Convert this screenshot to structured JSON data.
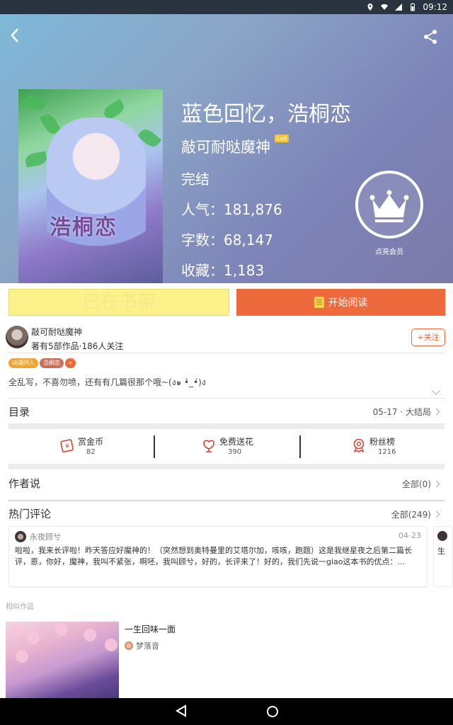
{
  "status_bar": {
    "time": "09:12"
  },
  "book": {
    "title": "蓝色回忆，浩桐恋",
    "author": "敲可耐哒魔神",
    "author_level": "Lv4",
    "status": "完结",
    "popularity": "人气：181,876",
    "word_count": "字数：68,147",
    "favorites": "收藏：1,183",
    "cover_text": "浩桐恋"
  },
  "vip": {
    "label": "点亮会员"
  },
  "buttons": {
    "on_shelf": "已在书架",
    "start_reading": "开始阅读"
  },
  "author_info": {
    "name": "敲可耐哒魔神",
    "meta": "著有5部作品·186人关注",
    "follow_label": "+关注"
  },
  "tags": [
    {
      "label": "动漫同人",
      "color": "#f0a431"
    },
    {
      "label": "浩桐恋",
      "color": "#c9705a"
    },
    {
      "label": "+",
      "color": "#ec6a3c"
    }
  ],
  "description": "全乱写，不喜勿喷，还有有几篇很那个哦~(ง๑ •̀_•́)ง",
  "catalog": {
    "title": "目录",
    "latest": "05-17 · 大结局"
  },
  "stats": [
    {
      "label": "赏金币",
      "value": "82",
      "icon": "reward-coin-icon"
    },
    {
      "label": "免费送花",
      "value": "390",
      "icon": "flower-icon"
    },
    {
      "label": "粉丝榜",
      "value": "1216",
      "icon": "medal-icon"
    }
  ],
  "author_says": {
    "title": "作者说",
    "link": "全部(0)"
  },
  "hot_comments": {
    "title": "热门评论",
    "link": "全部(249)",
    "items": [
      {
        "user": "永夜顾兮",
        "date": "04-23",
        "text": "啦啦，我来长评啦！昨天答应好魔神的！（突然想到奥特曼里的艾塔尔加，咳咳，跑题）这是我继星夜之后第二篇长评，恩，你好，魔神，我叫不紧张，啊呸，我叫顾兮，好的，长评来了！好的，我们先说一giao这本书的优点：..."
      }
    ],
    "peek_text": "生"
  },
  "similar": {
    "label": "相似作品",
    "items": [
      {
        "title": "一生回味一面",
        "author": "梦落音"
      }
    ]
  },
  "colors": {
    "accent": "#ec6a3c",
    "shelf_button": "#fbf28c"
  }
}
